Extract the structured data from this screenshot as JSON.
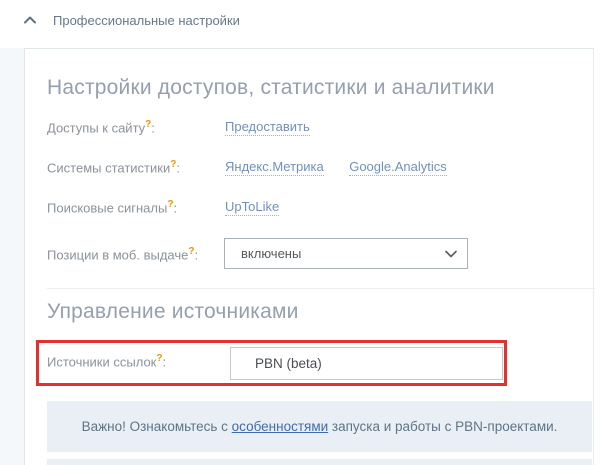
{
  "strings": {
    "colon": ":"
  },
  "colors": {
    "highlight_red": "#e53030",
    "link_blue": "#7191b8",
    "notice_link_blue": "#3f6cae",
    "label_gray": "#8b929b",
    "heading_gray": "#95a0ae",
    "help_orange": "#f39200",
    "notice_bg": "#e9eff4"
  },
  "section_header": {
    "label": "Профессиональные настройки"
  },
  "card": {
    "heading_access": "Настройки доступов, статистики и аналитики",
    "rows": [
      {
        "label": "Доступы к сайту",
        "help": "?",
        "links": [
          "Предоставить"
        ]
      },
      {
        "label": "Системы статистики",
        "help": "?",
        "links": [
          "Яндекс.Метрика",
          "Google.Analytics"
        ]
      },
      {
        "label": "Поисковые сигналы",
        "help": "?",
        "links": [
          "UpToLike"
        ]
      },
      {
        "label": "Позиции в моб. выдаче",
        "help": "?",
        "select_value": "включены"
      }
    ],
    "heading_sources": "Управление источниками",
    "sources_row": {
      "label": "Источники ссылок",
      "help": "?",
      "value": "PBN (beta)"
    },
    "notice": {
      "prefix": "Важно! Ознакомьтесь с ",
      "link": "особенностями",
      "suffix": " запуска и работы с PBN-проектами."
    }
  }
}
